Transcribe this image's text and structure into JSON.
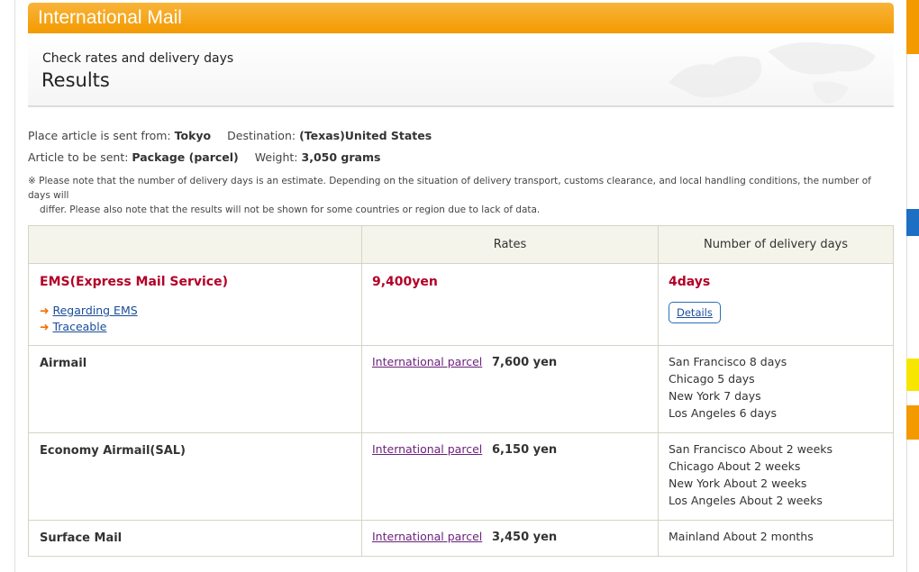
{
  "header": {
    "title": "International Mail",
    "subtitle": "Check rates and delivery days",
    "results": "Results"
  },
  "info": {
    "from_label": "Place article is sent from:",
    "from_value": "Tokyo",
    "dest_label": "Destination:",
    "dest_value": "(Texas)United States",
    "article_label": "Article to be sent:",
    "article_value": "Package (parcel)",
    "weight_label": "Weight:",
    "weight_value": "3,050 grams",
    "note_line1": "※ Please note that the number of delivery days is an estimate. Depending on the situation of delivery transport, customs clearance, and local handling conditions, the number of days will",
    "note_line2": "differ. Please also note that the results will not be shown for some countries or region due to lack of data."
  },
  "table": {
    "headers": [
      "",
      "Rates",
      "Number of delivery days"
    ],
    "ems": {
      "name": "EMS(Express Mail Service)",
      "link1": "Regarding EMS",
      "link2": "Traceable",
      "rate": "9,400yen",
      "days": "4days",
      "details": "Details"
    },
    "rows": [
      {
        "service": "Airmail",
        "link": "International parcel",
        "price": "7,600 yen",
        "days": [
          "San Francisco 8 days",
          "Chicago 5 days",
          "New York 7 days",
          "Los Angeles 6 days"
        ]
      },
      {
        "service": "Economy Airmail(SAL)",
        "link": "International parcel",
        "price": "6,150 yen",
        "days": [
          "San Francisco About 2 weeks",
          "Chicago About 2 weeks",
          "New York About 2 weeks",
          "Los Angeles About 2 weeks"
        ]
      },
      {
        "service": "Surface Mail",
        "link": "International parcel",
        "price": "3,450 yen",
        "days": [
          "Mainland About 2 months"
        ]
      }
    ]
  },
  "colors": {
    "header_orange": "#f39a00",
    "ems_red": "#b30027",
    "link_blue": "#1a4c99",
    "visited_purple": "#6b1f7a",
    "side_blue": "#1d6fc4",
    "side_yellow": "#f7e600"
  },
  "icons": {
    "link_arrow": "arrow-right-icon"
  }
}
